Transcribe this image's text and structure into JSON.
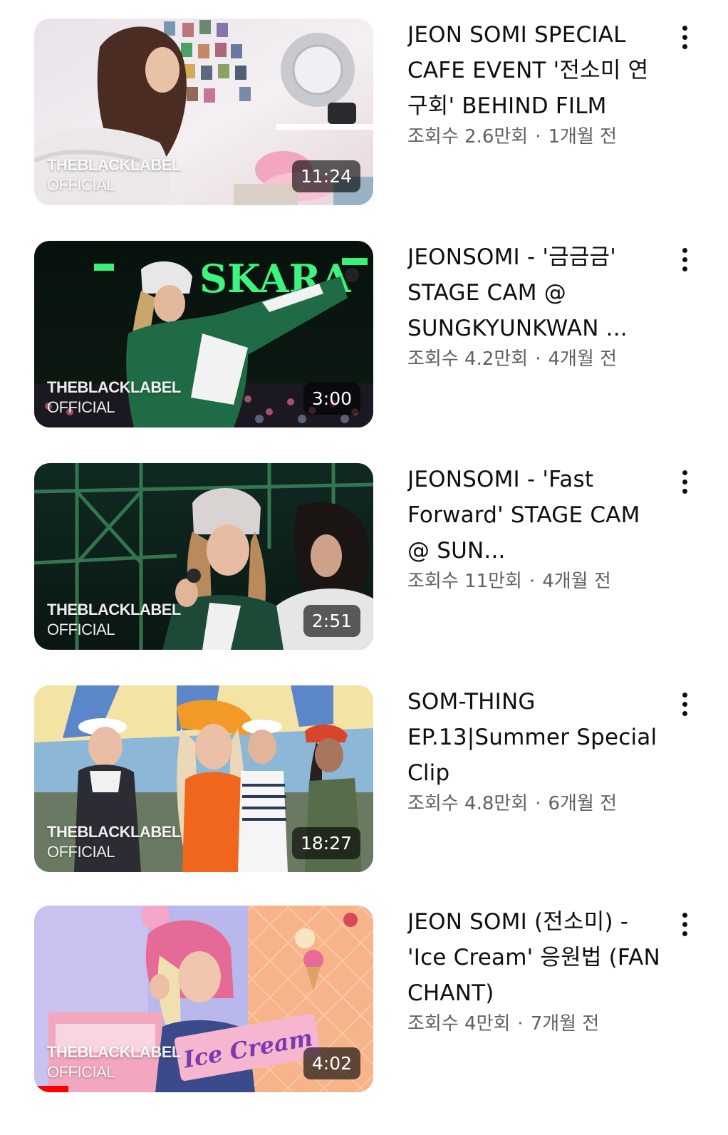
{
  "videos": [
    {
      "title": "JEON SOMI SPECIAL CAFE EVENT '전소미 연구회' BEHIND FILM",
      "views": "조회수 2.6만회",
      "age": "1개월 전",
      "duration": "11:24",
      "watermark": [
        "THEBLACKLABEL",
        "OFFICIAL"
      ]
    },
    {
      "title": "JEONSOMI - '금금금' STAGE CAM @ SUNGKYUNKWAN ...",
      "views": "조회수 4.2만회",
      "age": "4개월 전",
      "duration": "3:00",
      "watermark": [
        "THEBLACKLABEL",
        "OFFICIAL"
      ],
      "thumb_text": "SKARA"
    },
    {
      "title": "JEONSOMI - 'Fast Forward' STAGE CAM @ SUN...",
      "views": "조회수 11만회",
      "age": "4개월 전",
      "duration": "2:51",
      "watermark": [
        "THEBLACKLABEL",
        "OFFICIAL"
      ]
    },
    {
      "title": "SOM-THING EP.13|Summer Special Clip",
      "views": "조회수 4.8만회",
      "age": "6개월 전",
      "duration": "18:27",
      "watermark": [
        "THEBLACKLABEL",
        "OFFICIAL"
      ]
    },
    {
      "title": "JEON SOMI (전소미) - 'Ice Cream' 응원법 (FAN CHANT)",
      "views": "조회수 4만회",
      "age": "7개월 전",
      "duration": "4:02",
      "watermark": [
        "THEBLACKLABEL",
        "OFFICIAL"
      ],
      "thumb_text": "Ice Cream",
      "watched_fraction": 0.1
    }
  ],
  "icons": {
    "more": "vertical-ellipsis-icon"
  },
  "colors": {
    "progress": "#ff0000",
    "duration_badge": "#000000",
    "meta_text": "#606060"
  }
}
